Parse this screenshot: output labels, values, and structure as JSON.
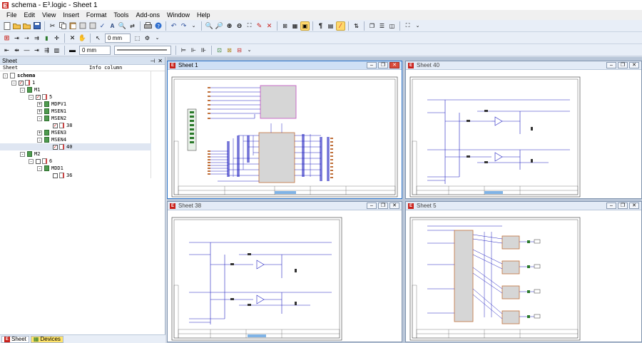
{
  "window": {
    "title": "schema - E³.logic - Sheet 1"
  },
  "menu": [
    "File",
    "Edit",
    "View",
    "Insert",
    "Format",
    "Tools",
    "Add-ons",
    "Window",
    "Help"
  ],
  "toolbar": {
    "grid1": "0 mm",
    "grid2": "0 mm"
  },
  "sidebar": {
    "title": "Sheet",
    "col_sheet": "Sheet",
    "col_info": "Info column",
    "tree": [
      {
        "label": "schema",
        "level": 0,
        "type": "doc",
        "pm": "-"
      },
      {
        "label": "1",
        "level": 1,
        "type": "page",
        "pm": "-",
        "cb": true
      },
      {
        "label": "M1",
        "level": 2,
        "type": "grp",
        "pm": "-"
      },
      {
        "label": "5",
        "level": 3,
        "type": "page",
        "pm": "-",
        "cb": true
      },
      {
        "label": "MDPV1",
        "level": 4,
        "type": "grp",
        "pm": "+"
      },
      {
        "label": "MSEN1",
        "level": 4,
        "type": "grp",
        "pm": "+"
      },
      {
        "label": "MSEN2",
        "level": 4,
        "type": "grp",
        "pm": "-"
      },
      {
        "label": "38",
        "level": 5,
        "type": "page",
        "cb": true
      },
      {
        "label": "MSEN3",
        "level": 4,
        "type": "grp",
        "pm": "+"
      },
      {
        "label": "MSEN4",
        "level": 4,
        "type": "grp",
        "pm": "-"
      },
      {
        "label": "40",
        "level": 5,
        "type": "page",
        "cb": true,
        "selected": true
      },
      {
        "label": "M2",
        "level": 2,
        "type": "grp",
        "pm": "-"
      },
      {
        "label": "6",
        "level": 3,
        "type": "page",
        "pm": "-",
        "cb": false
      },
      {
        "label": "MDD1",
        "level": 4,
        "type": "grp",
        "pm": "-"
      },
      {
        "label": "36",
        "level": 5,
        "type": "page",
        "cb": false
      }
    ],
    "tabs": {
      "sheet": "Sheet",
      "devices": "Devices"
    }
  },
  "windows": {
    "w1": {
      "title": "Sheet 1"
    },
    "w40": {
      "title": "Sheet 40"
    },
    "w38": {
      "title": "Sheet 38"
    },
    "w5": {
      "title": "Sheet 5"
    }
  },
  "colors": {
    "accent": "#2b73c8",
    "wire_blue": "#2020c0",
    "block_magenta": "#c04fc0",
    "block_orange": "#c0703a",
    "block_fill": "#d6d6d6"
  }
}
